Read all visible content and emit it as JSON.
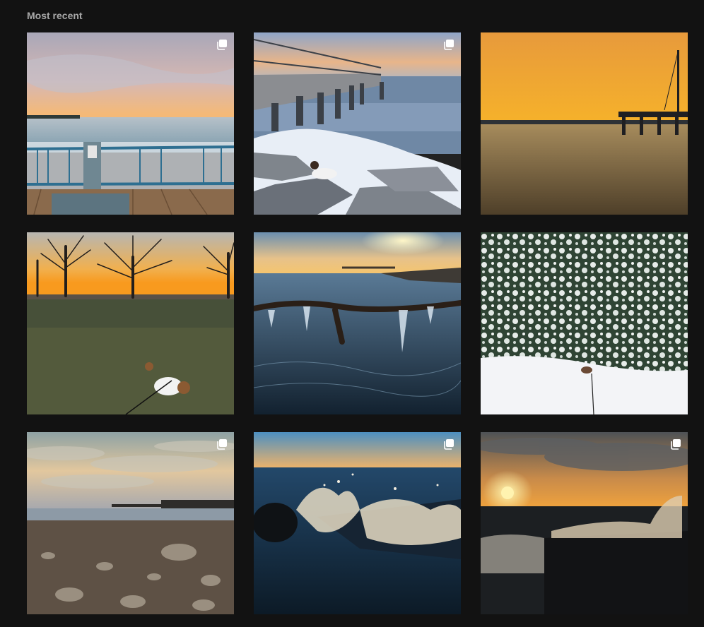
{
  "section": {
    "title": "Most recent"
  },
  "posts": [
    {
      "name": "post-pier-railing-sunset",
      "multi": true,
      "icon": "multiple-images-icon"
    },
    {
      "name": "post-pier-icy-rocks-dog",
      "multi": true,
      "icon": "multiple-images-icon"
    },
    {
      "name": "post-orange-sky-pier",
      "multi": false
    },
    {
      "name": "post-trees-sunset-dog",
      "multi": false
    },
    {
      "name": "post-icy-branch-water",
      "multi": false
    },
    {
      "name": "post-snowy-hedge-dog",
      "multi": false
    },
    {
      "name": "post-rocky-shore-clouds",
      "multi": true,
      "icon": "multiple-images-icon"
    },
    {
      "name": "post-wave-splash-rock",
      "multi": true,
      "icon": "multiple-images-icon"
    },
    {
      "name": "post-sunset-wave-splash",
      "multi": true,
      "icon": "multiple-images-icon"
    }
  ]
}
